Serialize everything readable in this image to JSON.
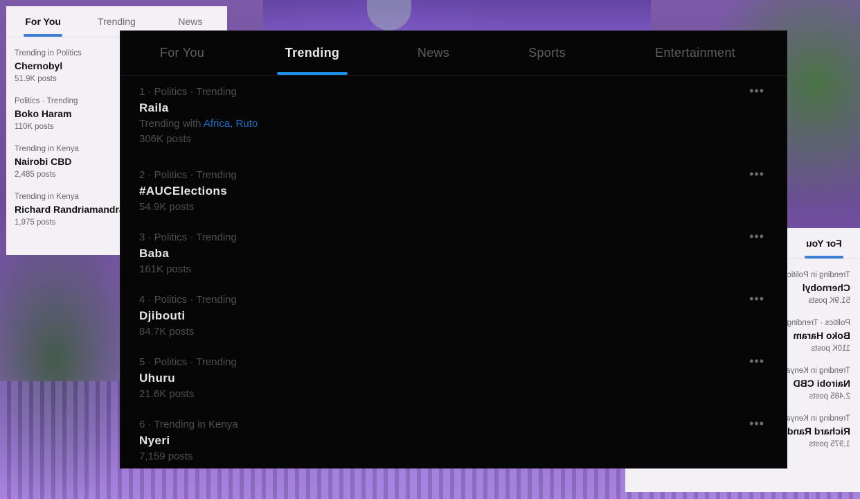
{
  "left_panel": {
    "tabs": [
      "For You",
      "Trending",
      "News"
    ],
    "items": [
      {
        "meta": "Trending in Politics",
        "title": "Chernobyl",
        "count": "51.9K posts"
      },
      {
        "meta": "Politics · Trending",
        "title": "Boko Haram",
        "count": "110K posts"
      },
      {
        "meta": "Trending in Kenya",
        "title": "Nairobi CBD",
        "count": "2,485 posts"
      },
      {
        "meta": "Trending in Kenya",
        "title": "Richard Randriamandrato",
        "count": "1,975 posts"
      }
    ]
  },
  "main_panel": {
    "tabs": [
      "For You",
      "Trending",
      "News",
      "Sports",
      "Entertainment"
    ],
    "more_icon": "•••",
    "trends": [
      {
        "meta": "1 · Politics · Trending",
        "title": "Raila",
        "with_label": "Trending with",
        "with_links": "Africa, Ruto",
        "count": "306K posts"
      },
      {
        "meta": "2 · Politics · Trending",
        "title": "#AUCElections",
        "count": "54.9K posts"
      },
      {
        "meta": "3 · Politics · Trending",
        "title": "Baba",
        "count": "161K posts"
      },
      {
        "meta": "4 · Politics · Trending",
        "title": "Djibouti",
        "count": "84.7K posts"
      },
      {
        "meta": "5 · Politics · Trending",
        "title": "Uhuru",
        "count": "21.6K posts"
      },
      {
        "meta": "6 · Trending in Kenya",
        "title": "Nyeri",
        "count": "7,159 posts"
      }
    ]
  },
  "right_panel": {
    "tabs": [
      "For You"
    ],
    "items": [
      {
        "meta": "Trending in Politics",
        "title": "Chernobyl",
        "count": "51.9K posts"
      },
      {
        "meta": "Politics · Trending",
        "title": "Boko Haram",
        "count": "110K posts"
      },
      {
        "meta": "Trending in Kenya",
        "title": "Nairobi CBD",
        "count": "2,485 posts"
      },
      {
        "meta": "Trending in Kenya",
        "title": "Richard Randriamandrato",
        "count": "1,975 posts"
      }
    ]
  },
  "colors": {
    "accent": "#1d8fe6",
    "link": "#1d6fc8",
    "dark_bg": "#060606",
    "light_bg": "#f3f1f5"
  }
}
